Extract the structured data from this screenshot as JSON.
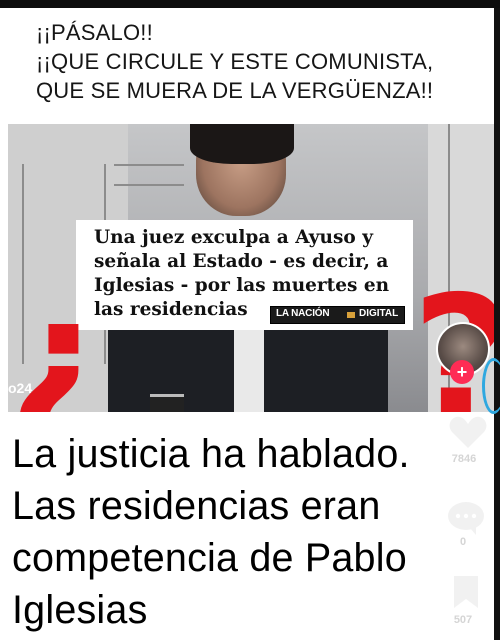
{
  "header": {
    "line1": "¡¡PÁSALO!!",
    "line2": "¡¡QUE CIRCULE Y ESTE COMUNISTA,",
    "line3": "QUE SE MUERA DE LA VERGÜENZA!!"
  },
  "video": {
    "corner_label": "o24",
    "headline": {
      "line1": "Una juez exculpa a Ayuso y",
      "line2": "señala al Estado - es decir, a",
      "line3": "Iglesias - por las muertes en",
      "line4": "las residencias"
    },
    "logo": {
      "part1": "LA NACIÓN",
      "part2": "DIGITAL"
    },
    "question_open": "¿",
    "question_close": "?"
  },
  "caption": {
    "line1": "La justicia ha hablado.",
    "line2": "Las residencias eran",
    "line3": "competencia de Pablo",
    "line4": "Iglesias"
  },
  "actions": {
    "like_count": "7846",
    "comment_count": "0",
    "save_count": "507"
  },
  "colors": {
    "accent_red": "#e3151c",
    "follow_pink": "#fe2c55"
  }
}
